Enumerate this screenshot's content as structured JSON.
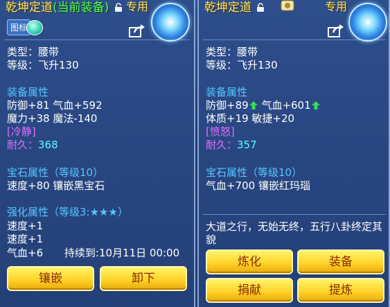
{
  "left": {
    "name": "乾坤定道",
    "current_tag": "(当前装备)",
    "exclusive": "专用",
    "toggle_label": "图标",
    "type_line": "类型：腰带",
    "level_line": "等级：飞升130",
    "attr_header": "装备属性",
    "attr_line1": "防御+81 气血+592",
    "attr_line2": "魔力+38 魔法-140",
    "special": "[冷静]",
    "durability_label": "耐久：",
    "durability_value": "368",
    "gem_header": "宝石属性（等级10）",
    "gem_line": "速度+80 镶嵌黑宝石",
    "enhance_header": "强化属性（等级3:★★★）",
    "enhance_line1": "速度+1",
    "enhance_line2": "速度+1",
    "enhance_line3_a": "气血+6",
    "enhance_line3_b": "持续到:10月11日 00:00",
    "btn_inlay": "镶嵌",
    "btn_unequip": "卸下"
  },
  "right": {
    "name": "乾坤定道",
    "exclusive": "专用",
    "type_line": "类型：腰带",
    "level_line": "等级：飞升130",
    "attr_header": "装备属性",
    "attr_def": "防御+89",
    "attr_hp": "气血+601",
    "attr_line2": "体质+19 敏捷+20",
    "special": "[愤怒]",
    "durability_label": "耐久：",
    "durability_value": "357",
    "gem_header": "宝石属性（等级10）",
    "gem_line": "气血+700 镶嵌红玛瑙",
    "description": "大道之行，无始无终，五行八卦终定其貌",
    "btn_refine": "炼化",
    "btn_equip": "装备",
    "btn_donate": "捐献",
    "btn_extract": "提炼"
  },
  "colors": {
    "title": "#ffe66b",
    "current": "#58ff58",
    "section": "#58c6ff",
    "special": "#e070ff",
    "durability": "#58ffff",
    "button": "#ffd42a"
  }
}
